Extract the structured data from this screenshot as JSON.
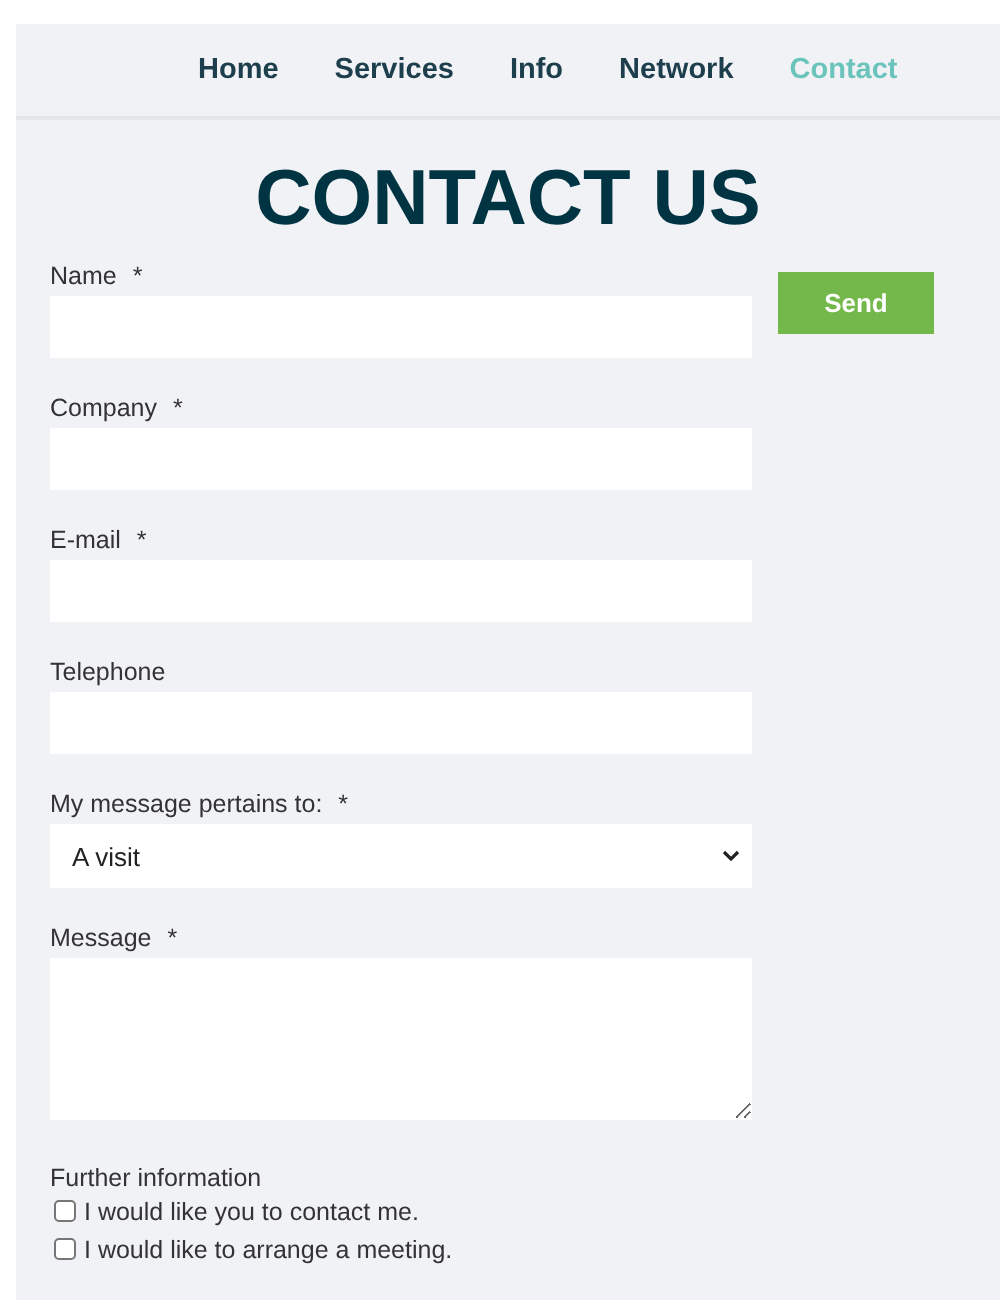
{
  "nav": [
    {
      "label": "Home",
      "selected": false
    },
    {
      "label": "Services",
      "selected": false
    },
    {
      "label": "Info",
      "selected": false
    },
    {
      "label": "Network",
      "selected": false
    },
    {
      "label": "Contact",
      "selected": true
    }
  ],
  "title": "CONTACT US",
  "send_button": "Send",
  "fields": [
    {
      "kind": "text",
      "label": "Name",
      "required_mark": "*"
    },
    {
      "kind": "text",
      "label": "Company",
      "required_mark": "*"
    },
    {
      "kind": "text",
      "label": "E-mail",
      "required_mark": "*"
    },
    {
      "kind": "text",
      "label": "Telephone"
    },
    {
      "kind": "select",
      "label": "My message pertains to:",
      "required_mark": "*",
      "value": "A visit"
    },
    {
      "kind": "textarea",
      "label": "Message",
      "required_mark": "*"
    }
  ],
  "further": {
    "heading": "Further information",
    "options": [
      {
        "label": "I would like you to contact me.",
        "checked": false
      },
      {
        "label": "I would like to arrange a meeting.",
        "checked": false
      }
    ]
  }
}
